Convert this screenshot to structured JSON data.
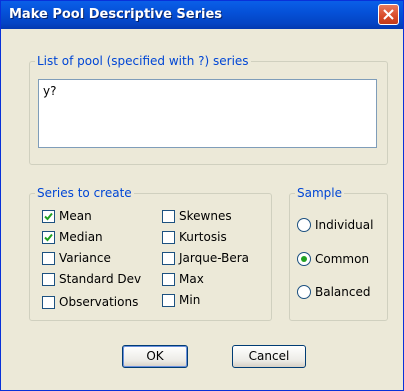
{
  "window": {
    "title": "Make Pool Descriptive Series"
  },
  "pool_group": {
    "legend": "List of pool (specified with ?) series",
    "value": "y?"
  },
  "series_group": {
    "legend": "Series to create",
    "items": [
      {
        "label": "Mean",
        "checked": true
      },
      {
        "label": "Median",
        "checked": true
      },
      {
        "label": "Variance",
        "checked": false
      },
      {
        "label": "Standard Dev",
        "checked": false
      },
      {
        "label": "Observations",
        "checked": false
      },
      {
        "label": "Skewnes",
        "checked": false
      },
      {
        "label": "Kurtosis",
        "checked": false
      },
      {
        "label": "Jarque-Bera",
        "checked": false
      },
      {
        "label": "Max",
        "checked": false
      },
      {
        "label": "Min",
        "checked": false
      }
    ]
  },
  "sample_group": {
    "legend": "Sample",
    "options": [
      {
        "label": "Individual",
        "selected": false
      },
      {
        "label": "Common",
        "selected": true
      },
      {
        "label": "Balanced",
        "selected": false
      }
    ]
  },
  "buttons": {
    "ok_label": "OK",
    "cancel_label": "Cancel"
  },
  "colors": {
    "titlebar": "#0551d8",
    "group_legend": "#0046d5",
    "dialog_bg": "#ece9d8",
    "check_mark": "#21a121"
  }
}
